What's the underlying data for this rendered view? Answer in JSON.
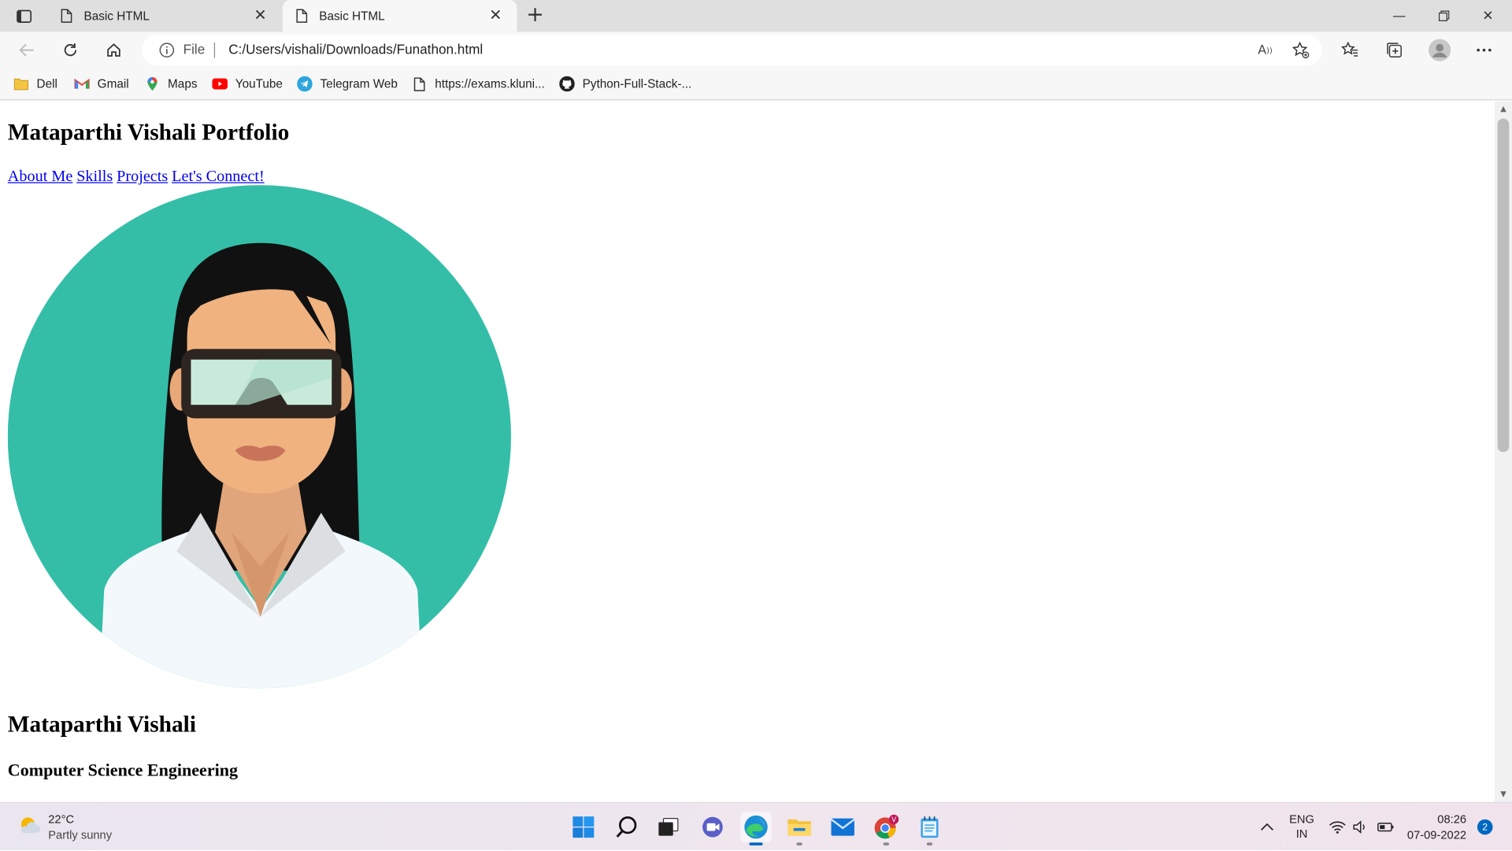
{
  "browser": {
    "tabs": [
      {
        "title": "Basic HTML",
        "active": false
      },
      {
        "title": "Basic HTML",
        "active": true
      }
    ],
    "address": {
      "scheme_label": "File",
      "url": "C:/Users/vishali/Downloads/Funathon.html"
    },
    "bookmarks": [
      {
        "label": "Dell",
        "icon": "folder-icon"
      },
      {
        "label": "Gmail",
        "icon": "gmail-icon"
      },
      {
        "label": "Maps",
        "icon": "maps-icon"
      },
      {
        "label": "YouTube",
        "icon": "youtube-icon"
      },
      {
        "label": "Telegram Web",
        "icon": "telegram-icon"
      },
      {
        "label": "https://exams.kluni...",
        "icon": "page-icon"
      },
      {
        "label": "Python-Full-Stack-...",
        "icon": "github-icon"
      }
    ]
  },
  "page": {
    "heading": "Mataparthi Vishali Portfolio",
    "nav_links": [
      "About Me",
      "Skills",
      "Projects",
      "Let's Connect!"
    ],
    "name": "Mataparthi Vishali",
    "department": "Computer Science Engineering",
    "avatar_colors": {
      "background": "#34bea8",
      "hair": "#111111",
      "skin": "#f0b27f",
      "goggles": "#c9eadb"
    }
  },
  "taskbar": {
    "weather": {
      "temp": "22°C",
      "condition": "Partly sunny"
    },
    "language": {
      "line1": "ENG",
      "line2": "IN"
    },
    "clock": {
      "time": "08:26",
      "date": "07-09-2022"
    },
    "notifications": "2"
  },
  "colors": {
    "link": "#0000ee",
    "accent": "#0067c0"
  }
}
